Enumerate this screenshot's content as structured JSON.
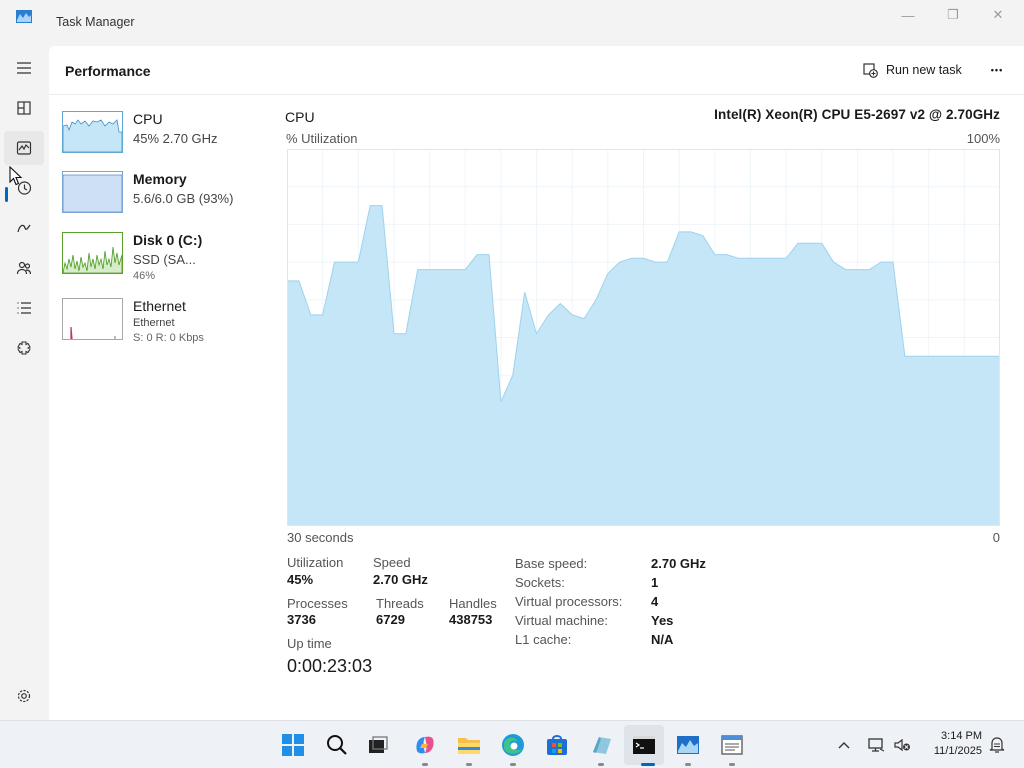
{
  "window": {
    "title": "Task Manager",
    "minimize_glyph": "—",
    "maximize_glyph": "❐",
    "close_glyph": "✕"
  },
  "nav": {
    "items": [
      {
        "name": "hamburger-menu-icon",
        "label": "Menu"
      },
      {
        "name": "processes-icon",
        "label": "Processes"
      },
      {
        "name": "performance-icon",
        "label": "Performance",
        "active": true
      },
      {
        "name": "app-history-icon",
        "label": "App history"
      },
      {
        "name": "startup-apps-icon",
        "label": "Startup apps"
      },
      {
        "name": "users-icon",
        "label": "Users"
      },
      {
        "name": "details-icon",
        "label": "Details"
      },
      {
        "name": "services-icon",
        "label": "Services"
      },
      {
        "name": "settings-icon",
        "label": "Settings"
      }
    ],
    "accent": "#0067c0"
  },
  "header": {
    "title": "Performance",
    "run_task_label": "Run new task",
    "more_glyph": "•••"
  },
  "resources": [
    {
      "name": "CPU",
      "sub": "45% 2.70 GHz",
      "sub2": ""
    },
    {
      "name": "Memory",
      "sub": "5.6/6.0 GB (93%)",
      "sub2": ""
    },
    {
      "name": "Disk 0 (C:)",
      "sub": "SSD (SA...",
      "sub2": "46%"
    },
    {
      "name": "Ethernet",
      "sub": "Ethernet",
      "sub2": "S: 0 R: 0 Kbps"
    }
  ],
  "detail": {
    "title": "CPU",
    "model": "Intel(R) Xeon(R) CPU E5-2697 v2 @ 2.70GHz",
    "util_label": "% Utilization",
    "util_max": "100%",
    "axis_left": "30 seconds",
    "axis_right": "0",
    "graph_fill": "#c5e6f6",
    "graph_line": "#9fd2ee",
    "stats": {
      "utilization_label": "Utilization",
      "utilization_value": "45%",
      "speed_label": "Speed",
      "speed_value": "2.70 GHz",
      "processes_label": "Processes",
      "processes_value": "3736",
      "threads_label": "Threads",
      "threads_value": "6729",
      "handles_label": "Handles",
      "handles_value": "438753",
      "uptime_label": "Up time",
      "uptime_value": "0:00:23:03"
    },
    "specs": [
      {
        "label": "Base speed:",
        "value": "2.70 GHz"
      },
      {
        "label": "Sockets:",
        "value": "1"
      },
      {
        "label": "Virtual processors:",
        "value": "4"
      },
      {
        "label": "Virtual machine:",
        "value": "Yes"
      },
      {
        "label": "L1 cache:",
        "value": "N/A"
      }
    ]
  },
  "chart_data": {
    "type": "area",
    "title": "",
    "xlabel": "30 seconds",
    "ylabel": "% Utilization",
    "xlim": [
      60,
      0
    ],
    "ylim": [
      0,
      100
    ],
    "grid": true,
    "x": [
      60,
      59,
      58,
      57,
      56,
      55,
      54,
      53,
      52,
      51,
      50,
      49,
      48,
      47,
      46,
      45,
      44,
      43,
      42,
      41,
      40,
      39,
      38,
      37,
      36,
      35,
      34,
      33,
      32,
      31,
      30,
      29,
      28,
      27,
      26,
      25,
      24,
      23,
      22,
      21,
      20,
      19,
      18,
      17,
      16,
      15,
      14,
      13,
      12,
      11,
      10,
      9,
      8,
      7,
      6,
      5,
      4,
      3,
      2,
      1,
      0
    ],
    "values": [
      65,
      65,
      56,
      56,
      70,
      70,
      70,
      85,
      85,
      51,
      51,
      68,
      68,
      68,
      68,
      68,
      72,
      72,
      33,
      40,
      62,
      51,
      56,
      59,
      56,
      55,
      60,
      67,
      70,
      71,
      71,
      70,
      70,
      78,
      78,
      77,
      72,
      72,
      71,
      71,
      71,
      71,
      71,
      75,
      75,
      75,
      70,
      68,
      68,
      68,
      70,
      70,
      45,
      45,
      45,
      45,
      45,
      45,
      45,
      45,
      45
    ]
  },
  "taskbar": {
    "icons": [
      {
        "name": "start-icon"
      },
      {
        "name": "search-icon"
      },
      {
        "name": "task-view-icon"
      },
      {
        "name": "copilot-icon"
      },
      {
        "name": "file-explorer-icon"
      },
      {
        "name": "edge-icon"
      },
      {
        "name": "store-icon"
      },
      {
        "name": "app-icon"
      },
      {
        "name": "terminal-icon"
      },
      {
        "name": "task-manager-icon"
      },
      {
        "name": "notepad-icon"
      }
    ],
    "time": "3:14 PM",
    "date": "11/1/2025"
  }
}
